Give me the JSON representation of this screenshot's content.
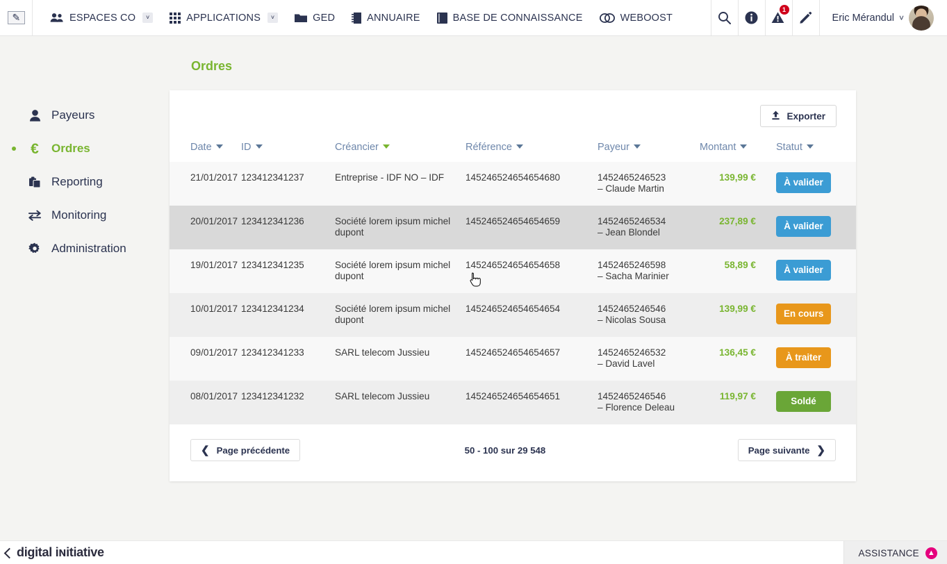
{
  "topbar": {
    "logo_icon": "edit-pencil-icon",
    "nav": [
      {
        "label": "ESPACES CO",
        "icon": "users-group-icon",
        "caret": "˅"
      },
      {
        "label": "APPLICATIONS",
        "icon": "grid-apps-icon",
        "caret": "˅"
      },
      {
        "label": "GED",
        "icon": "folder-icon",
        "caret": ""
      },
      {
        "label": "ANNUAIRE",
        "icon": "address-book-icon",
        "caret": ""
      },
      {
        "label": "BASE DE CONNAISSANCE",
        "icon": "book-icon",
        "caret": ""
      },
      {
        "label": "WEBOOST",
        "icon": "chain-links-icon",
        "caret": ""
      }
    ],
    "icons": [
      {
        "name": "search-icon",
        "glyph": "⌕"
      },
      {
        "name": "info-icon",
        "glyph": "i"
      },
      {
        "name": "alert-warning-icon",
        "glyph": "!",
        "badge": "1"
      },
      {
        "name": "edit-pencil-icon",
        "glyph": "✎"
      }
    ],
    "user": {
      "name": "Eric Mérandul",
      "caret": "˅",
      "avatar": "user-avatar"
    }
  },
  "sidebar": {
    "items": [
      {
        "label": "Payeurs",
        "icon": "person-icon",
        "active": false
      },
      {
        "label": "Ordres",
        "icon": "euro-icon",
        "active": true
      },
      {
        "label": "Reporting",
        "icon": "clipboard-icon",
        "active": false
      },
      {
        "label": "Monitoring",
        "icon": "exchange-arrows-icon",
        "active": false
      },
      {
        "label": "Administration",
        "icon": "gear-icon",
        "active": false
      }
    ]
  },
  "main": {
    "title": "Ordres",
    "export_label": "Exporter",
    "export_icon": "upload-icon",
    "columns": [
      {
        "label": "Date",
        "sorted": false
      },
      {
        "label": "ID",
        "sorted": false
      },
      {
        "label": "Créancier",
        "sorted": true
      },
      {
        "label": "Référence",
        "sorted": false
      },
      {
        "label": "Payeur",
        "sorted": false
      },
      {
        "label": "Montant",
        "sorted": false
      },
      {
        "label": "Statut",
        "sorted": false
      }
    ],
    "rows": [
      {
        "date": "21/01/2017",
        "id": "123412341237",
        "creancier": "Entreprise - IDF NO – IDF",
        "reference": "145246524654654680",
        "payeur_id": "1452465246523",
        "payeur_name": "– Claude Martin",
        "montant": "139,99 €",
        "statut": "À valider",
        "statut_color": "blue",
        "hover": false
      },
      {
        "date": "20/01/2017",
        "id": "123412341236",
        "creancier": "Société lorem ipsum michel dupont",
        "reference": "145246524654654659",
        "payeur_id": "1452465246534",
        "payeur_name": "– Jean Blondel",
        "montant": "237,89 €",
        "statut": "À valider",
        "statut_color": "blue",
        "hover": true
      },
      {
        "date": "19/01/2017",
        "id": "123412341235",
        "creancier": "Société lorem ipsum michel dupont",
        "reference": "145246524654654658",
        "payeur_id": "1452465246598",
        "payeur_name": "– Sacha Marinier",
        "montant": "58,89 €",
        "statut": "À valider",
        "statut_color": "blue",
        "hover": false
      },
      {
        "date": "10/01/2017",
        "id": "123412341234",
        "creancier": "Société lorem ipsum michel dupont",
        "reference": "145246524654654654",
        "payeur_id": "1452465246546",
        "payeur_name": "– Nicolas Sousa",
        "montant": "139,99 €",
        "statut": "En cours",
        "statut_color": "orange",
        "hover": false
      },
      {
        "date": "09/01/2017",
        "id": "123412341233",
        "creancier": "SARL telecom Jussieu",
        "reference": "145246524654654657",
        "payeur_id": "1452465246532",
        "payeur_name": "– David Lavel",
        "montant": "136,45 €",
        "statut": "À traiter",
        "statut_color": "orange",
        "hover": false
      },
      {
        "date": "08/01/2017",
        "id": "123412341232",
        "creancier": "SARL telecom Jussieu",
        "reference": "145246524654654651",
        "payeur_id": "1452465246546",
        "payeur_name": "– Florence Deleau",
        "montant": "119,97 €",
        "statut": "Soldé",
        "statut_color": "green",
        "hover": false
      }
    ],
    "pager": {
      "prev_label": "Page précédente",
      "next_label": "Page suivante",
      "info": "50 - 100 sur 29 548",
      "prev_icon": "chevron-left-icon",
      "next_icon": "chevron-right-icon"
    }
  },
  "footer": {
    "brand": "digital iɴitiative",
    "assistance_label": "ASSISTANCE",
    "assistance_icon": "arrow-up-circle-icon"
  },
  "colors": {
    "accent_green": "#79b530",
    "status_blue": "#3b9cd4",
    "status_orange": "#e8971b",
    "status_green": "#6aa637",
    "navy": "#2b3350",
    "assistance_pink": "#e5007d",
    "alert_red": "#d0021b"
  }
}
